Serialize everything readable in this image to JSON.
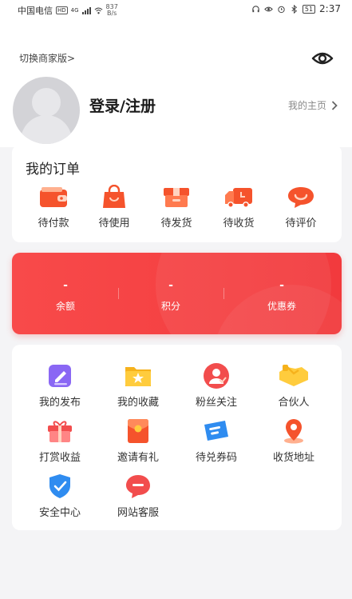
{
  "status_bar": {
    "carrier": "中国电信",
    "hd": "HD",
    "network": "4G",
    "speed_value": "837",
    "speed_unit": "B/s",
    "battery": "51",
    "time": "2:37"
  },
  "header": {
    "switch_label": "切换商家版>",
    "login_label": "登录/注册",
    "home_label": "我的主页"
  },
  "orders": {
    "title": "我的订单",
    "items": [
      {
        "label": "待付款",
        "icon": "wallet-icon",
        "color": "#f5532c"
      },
      {
        "label": "待使用",
        "icon": "shopping-bag-icon",
        "color": "#f5532c"
      },
      {
        "label": "待发货",
        "icon": "box-icon",
        "color": "#f5532c"
      },
      {
        "label": "待收货",
        "icon": "truck-icon",
        "color": "#f5532c"
      },
      {
        "label": "待评价",
        "icon": "chat-bubble-icon",
        "color": "#f5532c"
      }
    ]
  },
  "stats": {
    "items": [
      {
        "value": "-",
        "label": "余额"
      },
      {
        "value": "-",
        "label": "积分"
      },
      {
        "value": "-",
        "label": "优惠券"
      }
    ],
    "accent": "#f5423f"
  },
  "services": {
    "items": [
      {
        "label": "我的发布",
        "icon": "edit-icon",
        "color": "#7d5cf0"
      },
      {
        "label": "我的收藏",
        "icon": "star-folder-icon",
        "color": "#f6b21c"
      },
      {
        "label": "粉丝关注",
        "icon": "fans-icon",
        "color": "#f24d4d"
      },
      {
        "label": "合伙人",
        "icon": "handshake-icon",
        "color": "#f6b21c"
      },
      {
        "label": "打赏收益",
        "icon": "gift-icon",
        "color": "#f24d4d"
      },
      {
        "label": "邀请有礼",
        "icon": "envelope-icon",
        "color": "#f5532c"
      },
      {
        "label": "待兑券码",
        "icon": "ticket-icon",
        "color": "#2f8cf0"
      },
      {
        "label": "收货地址",
        "icon": "location-pin-icon",
        "color": "#f5532c"
      },
      {
        "label": "安全中心",
        "icon": "shield-icon",
        "color": "#2f8cf0"
      },
      {
        "label": "网站客服",
        "icon": "customer-service-icon",
        "color": "#f24d4d"
      }
    ]
  }
}
